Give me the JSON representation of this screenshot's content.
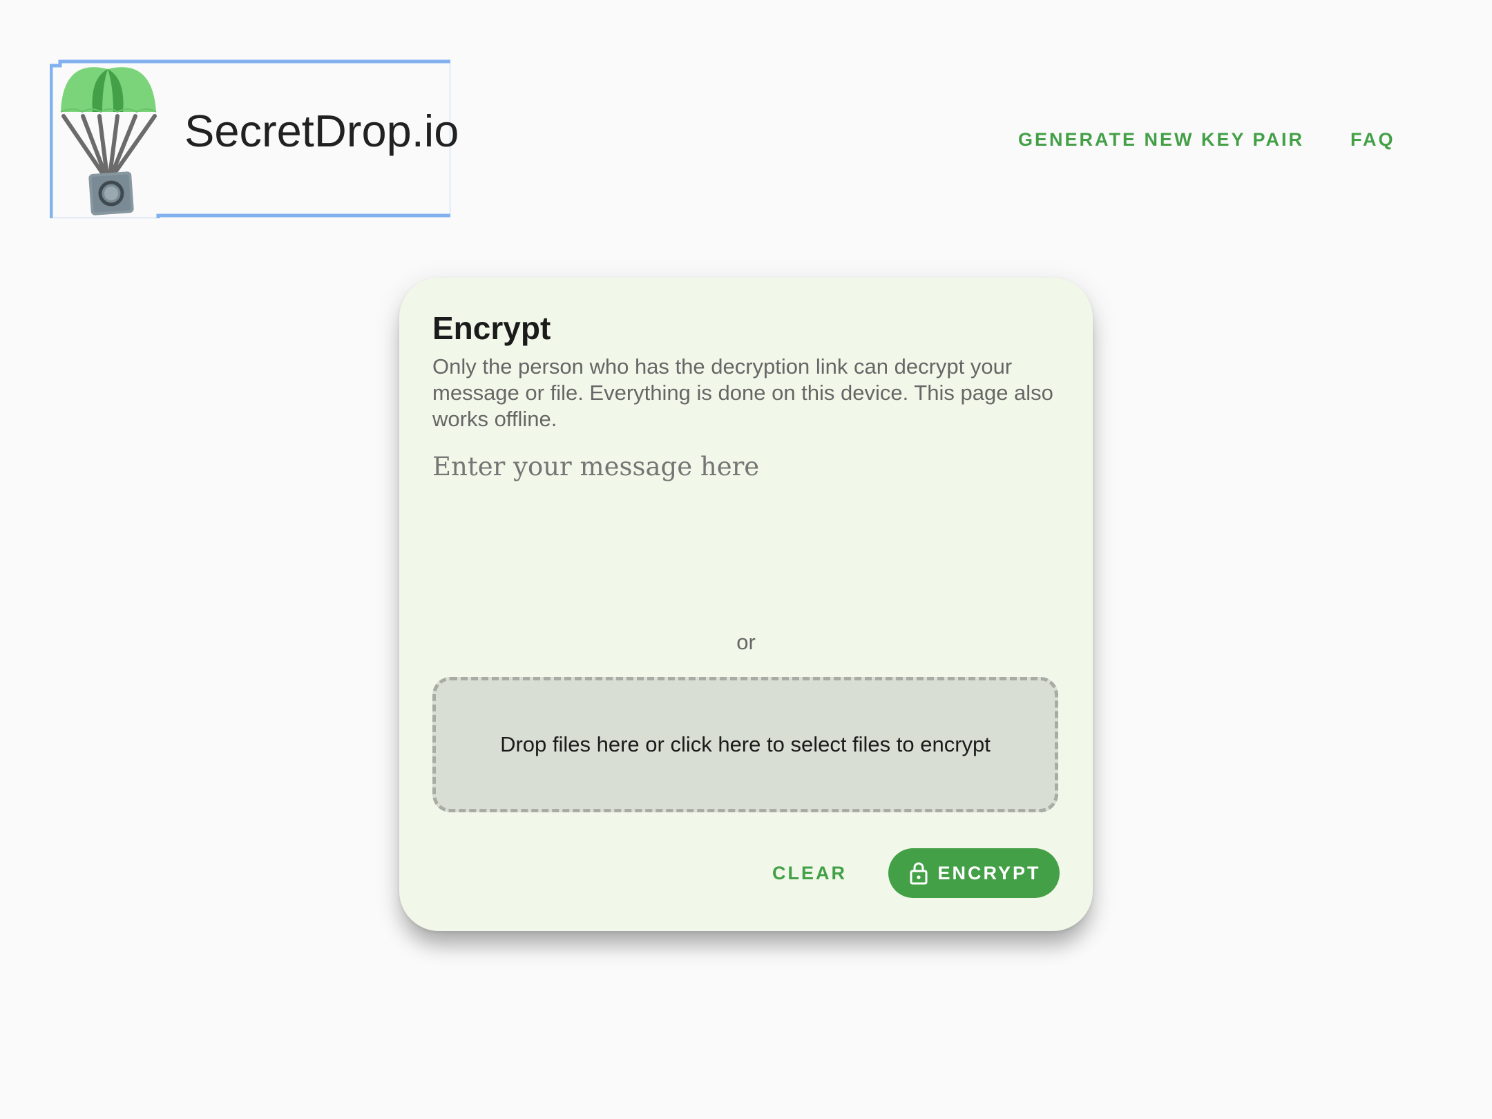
{
  "header": {
    "logo_text": "SecretDrop.io",
    "logo_icon": "parachute-safe-icon",
    "nav": [
      {
        "label": "GENERATE NEW KEY PAIR"
      },
      {
        "label": "FAQ"
      }
    ]
  },
  "encrypt_card": {
    "title": "Encrypt",
    "description": "Only the person who has the decryption link can decrypt your message or file. Everything is done on this device. This page also works offline.",
    "message_input": {
      "value": "",
      "placeholder": "Enter your message here"
    },
    "separator": "or",
    "dropzone_text": "Drop files here or click here to select files to encrypt",
    "clear_label": "CLEAR",
    "encrypt_label": "ENCRYPT",
    "encrypt_icon": "lock-icon"
  },
  "colors": {
    "accent": "#43a047",
    "card_background": "#f1f8e9",
    "page_background": "#fafafa",
    "focus_ring": "#82b1f0"
  }
}
